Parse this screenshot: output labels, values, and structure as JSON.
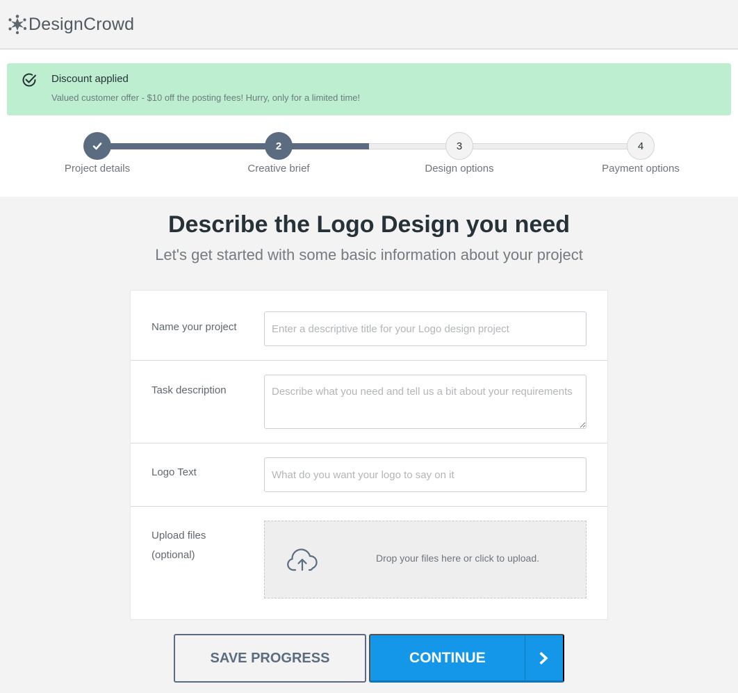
{
  "header": {
    "brand": "DesignCrowd",
    "logo_icon": "starburst-crowd-icon"
  },
  "alert": {
    "icon": "check-circle-icon",
    "title": "Discount applied",
    "message": "Valued customer offer - $10 off the posting fees! Hurry, only for a limited time!",
    "background": "#bdeecf"
  },
  "stepper": {
    "progress_percent": 50,
    "steps": [
      {
        "number": "1",
        "label": "Project details",
        "state": "done",
        "icon": "checkmark-icon"
      },
      {
        "number": "2",
        "label": "Creative brief",
        "state": "active"
      },
      {
        "number": "3",
        "label": "Design options",
        "state": "todo"
      },
      {
        "number": "4",
        "label": "Payment options",
        "state": "todo"
      }
    ],
    "active_color": "#5c6c80"
  },
  "page": {
    "title": "Describe the Logo Design you need",
    "subtitle": "Let's get started with some basic information about your project"
  },
  "form": {
    "project_name": {
      "label": "Name your project",
      "value": "",
      "placeholder": "Enter a descriptive title for your Logo design project"
    },
    "task_description": {
      "label": "Task description",
      "value": "",
      "placeholder": "Describe what you need and tell us a bit about your requirements"
    },
    "logo_text": {
      "label": "Logo Text",
      "value": "",
      "placeholder": "What do you want your logo to say on it"
    },
    "upload": {
      "label_line1": "Upload files",
      "label_line2": "(optional)",
      "icon": "cloud-upload-icon",
      "text": "Drop your files here or click to upload."
    }
  },
  "actions": {
    "save_label": "SAVE PROGRESS",
    "continue_label": "CONTINUE",
    "continue_icon": "chevron-right-icon",
    "primary_color": "#1497e8"
  }
}
